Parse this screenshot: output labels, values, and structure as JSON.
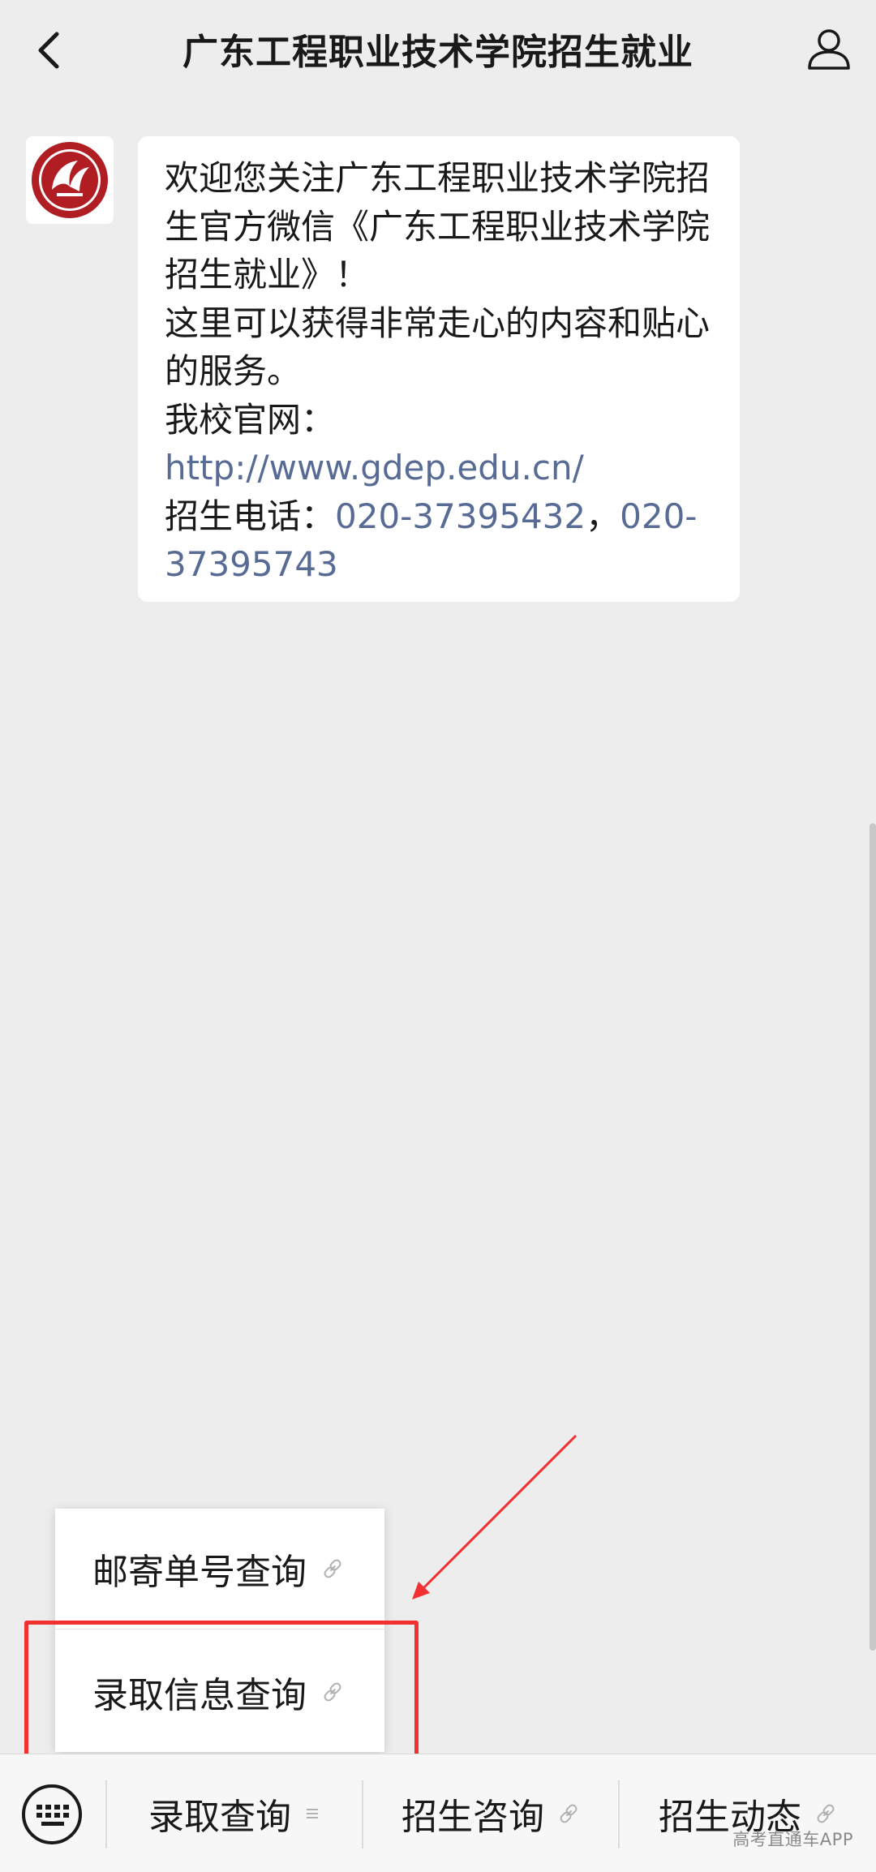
{
  "header": {
    "title": "广东工程职业技术学院招生就业",
    "back_icon": "chevron-left-icon",
    "profile_icon": "user-icon"
  },
  "message": {
    "avatar_icon": "school-logo-icon",
    "lines": {
      "welcome": "欢迎您关注广东工程职业技术学院招生官方微信《广东工程职业技术学院招生就业》！",
      "service": "这里可以获得非常走心的内容和贴心的服务。",
      "website_label": "我校官网：",
      "website_url": "http://www.gdep.edu.cn/",
      "phone_label": "招生电话：",
      "phone_1": "020-37395432",
      "phone_sep": "，",
      "phone_2": "020-37395743"
    }
  },
  "submenu": {
    "items": [
      {
        "label": "邮寄单号查询",
        "icon": "link-icon"
      },
      {
        "label": "录取信息查询",
        "icon": "link-icon"
      }
    ]
  },
  "bottom_menu": {
    "keyboard_icon": "keyboard-icon",
    "tabs": [
      {
        "label": "录取查询",
        "icon": "submenu-lines-icon"
      },
      {
        "label": "招生咨询",
        "icon": "link-icon"
      },
      {
        "label": "招生动态",
        "icon": "link-icon"
      }
    ]
  },
  "watermark": "高考直通车APP",
  "colors": {
    "link": "#576b95",
    "highlight": "#f23030",
    "background": "#ededed"
  }
}
